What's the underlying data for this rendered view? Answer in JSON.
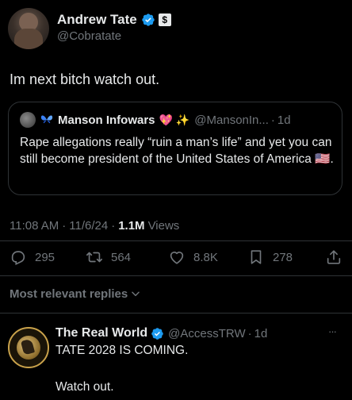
{
  "author": {
    "name": "Andrew Tate",
    "handle": "@Cobratate",
    "badge_glyph": "$"
  },
  "tweet": {
    "text": "Im next bitch watch out."
  },
  "quote": {
    "name": "Manson Infowars",
    "emoji": "💖 ✨",
    "handle": "@MansonIn...",
    "time": "1d",
    "text": "Rape allegations really “ruin a man’s life” and yet you can still become president of the United States of America",
    "flag": "🇺🇸",
    "trail": "."
  },
  "meta": {
    "time": "11:08 AM",
    "date": "11/6/24",
    "views_count": "1.1M",
    "views_label": "Views"
  },
  "actions": {
    "replies": "295",
    "retweets": "564",
    "likes": "8.8K",
    "bookmarks": "278"
  },
  "replies_filter": {
    "label": "Most relevant replies"
  },
  "reply": {
    "name": "The Real World",
    "handle": "@AccessTRW",
    "time": "1d",
    "line1": "TATE 2028 IS COMING.",
    "line2": "Watch out.",
    "more": "···"
  },
  "colors": {
    "background": "#000000",
    "text": "#e7e9ea",
    "muted": "#71767b",
    "verified": "#1d9bf0",
    "gold": "#c9a24b"
  },
  "icons": [
    "verified-badge-icon",
    "affiliate-badge-icon",
    "reply-icon",
    "retweet-icon",
    "like-icon",
    "bookmark-icon",
    "share-icon",
    "chevron-down-icon",
    "butterfly-icon",
    "more-icon"
  ]
}
